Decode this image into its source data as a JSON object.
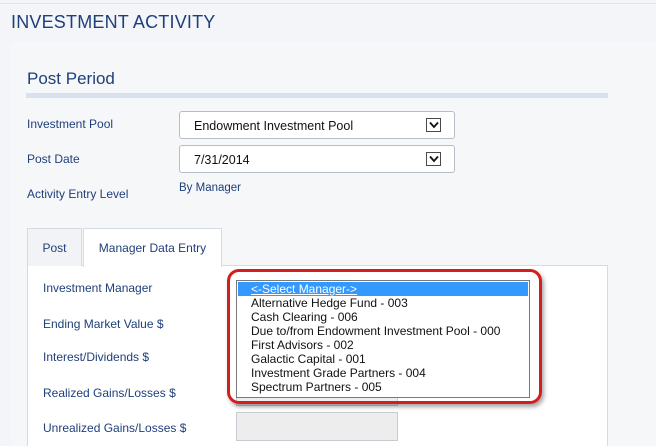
{
  "page": {
    "title": "INVESTMENT ACTIVITY"
  },
  "post_period": {
    "title": "Post Period",
    "investment_pool": {
      "label": "Investment Pool",
      "value": "Endowment Investment Pool"
    },
    "post_date": {
      "label": "Post Date",
      "value": "7/31/2014"
    },
    "activity_entry_level": {
      "label": "Activity Entry Level",
      "value": "By Manager"
    }
  },
  "tabs": [
    {
      "label": "Post",
      "active": false
    },
    {
      "label": "Manager Data Entry",
      "active": true
    }
  ],
  "form": {
    "investment_manager_label": "Investment Manager",
    "ending_market_value_label": "Ending Market Value $",
    "interest_dividends_label": "Interest/Dividends $",
    "realized_gains_label": "Realized Gains/Losses $",
    "unrealized_gains_label": "Unrealized Gains/Losses $"
  },
  "manager_dropdown": {
    "selected_index": 0,
    "options": [
      "<-Select Manager->",
      "Alternative Hedge Fund - 003",
      "Cash Clearing - 006",
      "Due to/from Endowment Investment Pool - 000",
      "First Advisors - 002",
      "Galactic Capital - 001",
      "Investment Grade Partners - 004",
      "Spectrum Partners - 005"
    ]
  },
  "colors": {
    "heading": "#1f3f7a",
    "highlight": "#d21e1e",
    "selection": "#3399ff"
  },
  "icons": {
    "select_arrow": "chevron-down-icon"
  }
}
